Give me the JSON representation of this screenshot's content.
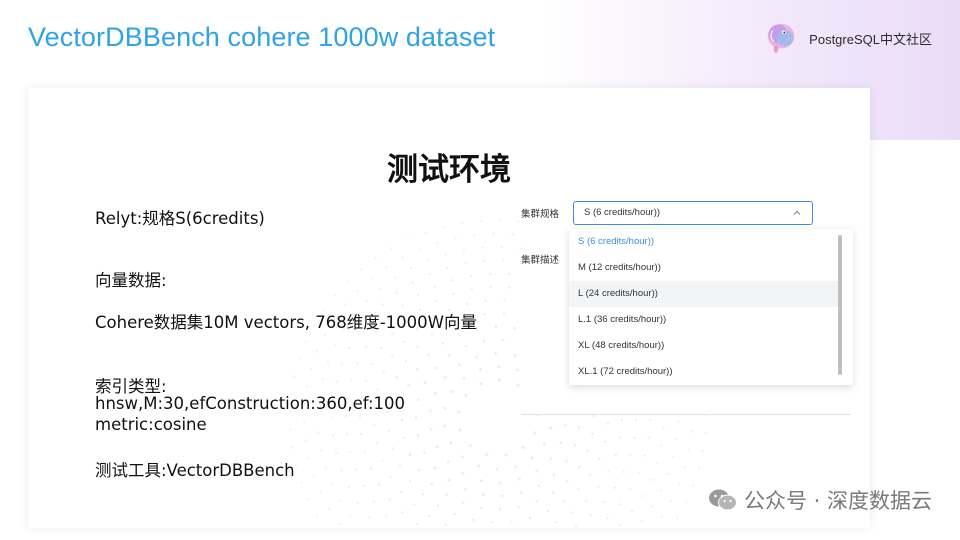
{
  "slide": {
    "title": "VectorDBBench cohere 1000w dataset",
    "brand": "PostgreSQL中文社区",
    "heading": "测试环境",
    "lines": [
      "Relyt:规格S(6credits)",
      "向量数据:",
      "Cohere数据集10M vectors, 768维度-1000W向量",
      "索引类型:",
      "hnsw,M:30,efConstruction:360,ef:100",
      "metric:cosine",
      "测试工具:VectorDBBench"
    ],
    "watermark": "公众号 · 深度数据云"
  },
  "ui": {
    "cluster_spec_label": "集群规格",
    "cluster_desc_label": "集群描述",
    "select_value": "S (6 credits/hour))",
    "options": [
      "S (6 credits/hour))",
      "M (12 credits/hour))",
      "L (24 credits/hour))",
      "L.1 (36 credits/hour))",
      "XL (48 credits/hour))",
      "XL.1 (72 credits/hour))"
    ],
    "selected_index": 0,
    "hover_index": 2,
    "accent_color": "#3e8ee8",
    "title_color": "#2fa3e6"
  },
  "icons": {
    "brand_logo": "elephant-logo-icon",
    "select_arrow": "chevron-down-icon",
    "watermark": "wechat-icon"
  }
}
